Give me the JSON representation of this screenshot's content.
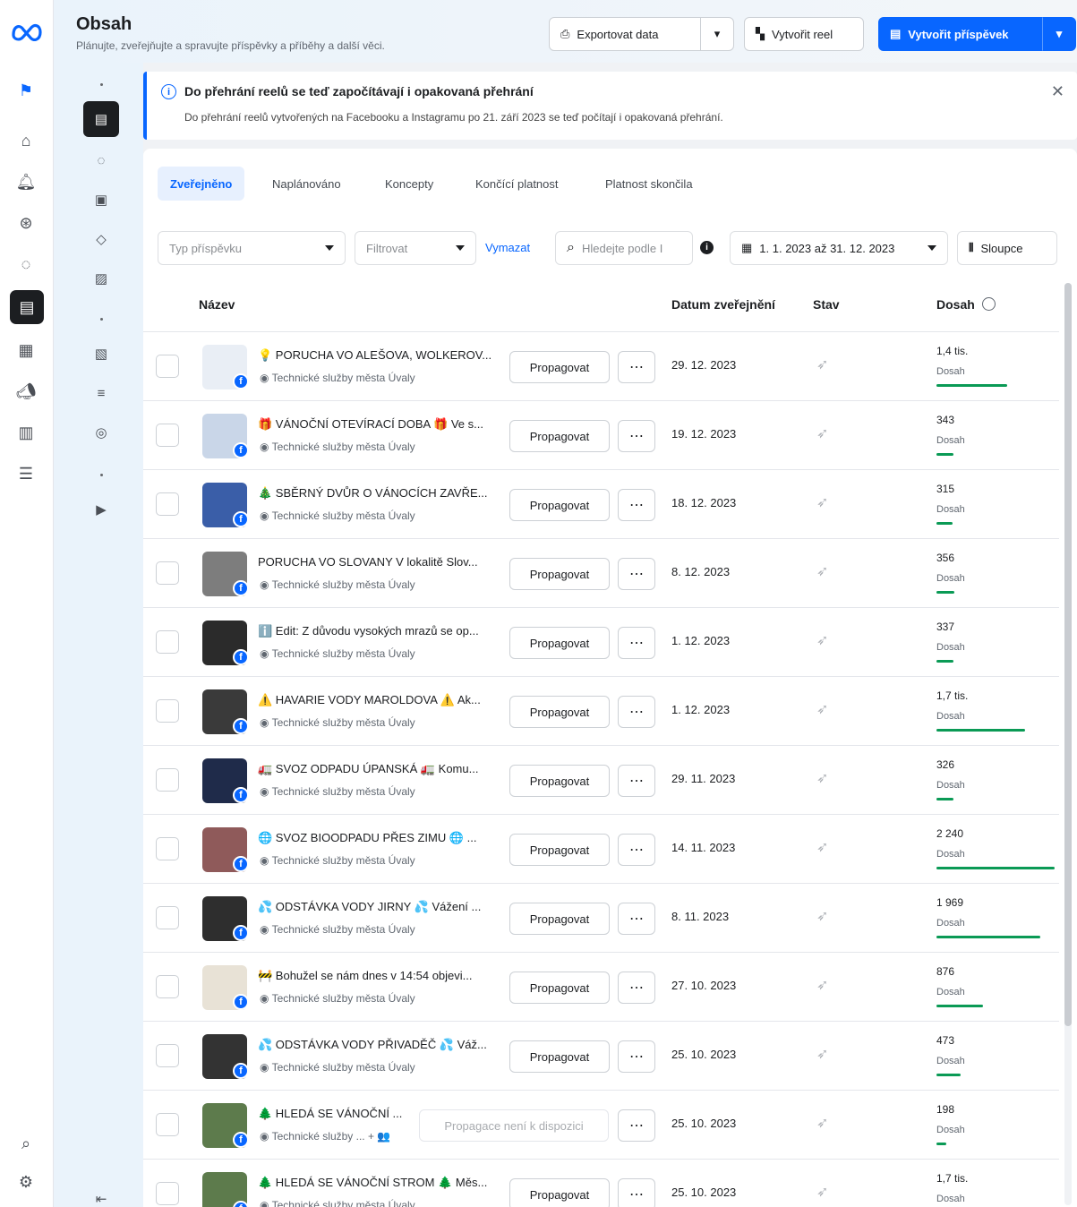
{
  "header": {
    "title": "Obsah",
    "subtitle": "Plánujte, zveřejňujte a spravujte příspěvky a příběhy a další věci.",
    "export_label": "Exportovat data",
    "create_reel_label": "Vytvořit reel",
    "create_post_label": "Vytvořit příspěvek"
  },
  "banner": {
    "title": "Do přehrání reelů se teď započítávají i opakovaná přehrání",
    "text": "Do přehrání reelů vytvořených na Facebooku a Instagramu po 21. září 2023 se teď počítají i opakovaná přehrání."
  },
  "tabs": [
    {
      "label": "Zveřejněno",
      "active": true
    },
    {
      "label": "Naplánováno"
    },
    {
      "label": "Koncepty"
    },
    {
      "label": "Končící platnost"
    },
    {
      "label": "Platnost skončila"
    }
  ],
  "filters": {
    "post_type_placeholder": "Typ příspěvku",
    "filter_placeholder": "Filtrovat",
    "clear_label": "Vymazat",
    "search_placeholder": "Hledejte podle I",
    "date_range": "1. 1. 2023 až 31. 12. 2023",
    "columns_label": "Sloupce"
  },
  "columns": {
    "name": "Název",
    "published": "Datum zveřejnění",
    "status": "Stav",
    "reach": "Dosah"
  },
  "rows": [
    {
      "title": "💡 PORUCHA VO ALEŠOVA, WOLKEROV...",
      "page": "Technické služby města Úvaly",
      "promo": "Propagovat",
      "date": "29. 12. 2023",
      "reach": "1,4 tis.",
      "reach_label": "Dosah",
      "reach_fraction": 0.58
    },
    {
      "title": "🎁 VÁNOČNÍ OTEVÍRACÍ DOBA 🎁 Ve s...",
      "page": "Technické služby města Úvaly",
      "promo": "Propagovat",
      "date": "19. 12. 2023",
      "reach": "343",
      "reach_label": "Dosah",
      "reach_fraction": 0.14
    },
    {
      "title": "🎄 SBĚRNÝ DVŮR O VÁNOCÍCH ZAVŘE...",
      "page": "Technické služby města Úvaly",
      "promo": "Propagovat",
      "date": "18. 12. 2023",
      "reach": "315",
      "reach_label": "Dosah",
      "reach_fraction": 0.13
    },
    {
      "title": "PORUCHA VO SLOVANY V lokalitě Slov...",
      "page": "Technické služby města Úvaly",
      "promo": "Propagovat",
      "date": "8. 12. 2023",
      "reach": "356",
      "reach_label": "Dosah",
      "reach_fraction": 0.15
    },
    {
      "title": "ℹ️ Edit: Z důvodu vysokých mrazů se op...",
      "page": "Technické služby města Úvaly",
      "promo": "Propagovat",
      "date": "1. 12. 2023",
      "reach": "337",
      "reach_label": "Dosah",
      "reach_fraction": 0.14
    },
    {
      "title": "⚠️ HAVARIE VODY MAROLDOVA ⚠️ Ak...",
      "page": "Technické služby města Úvaly",
      "promo": "Propagovat",
      "date": "1. 12. 2023",
      "reach": "1,7 tis.",
      "reach_label": "Dosah",
      "reach_fraction": 0.73
    },
    {
      "title": "🚛 SVOZ ODPADU ÚPANSKÁ 🚛 Komu...",
      "page": "Technické služby města Úvaly",
      "promo": "Propagovat",
      "date": "29. 11. 2023",
      "reach": "326",
      "reach_label": "Dosah",
      "reach_fraction": 0.14
    },
    {
      "title": "🌐 SVOZ BIOODPADU PŘES ZIMU 🌐 ...",
      "page": "Technické služby města Úvaly",
      "promo": "Propagovat",
      "date": "14. 11. 2023",
      "reach": "2 240",
      "reach_label": "Dosah",
      "reach_fraction": 0.97
    },
    {
      "title": "💦 ODSTÁVKA VODY JIRNY 💦 Vážení ...",
      "page": "Technické služby města Úvaly",
      "promo": "Propagovat",
      "date": "8. 11. 2023",
      "reach": "1 969",
      "reach_label": "Dosah",
      "reach_fraction": 0.85
    },
    {
      "title": "🚧 Bohužel se nám dnes v 14:54 objevi...",
      "page": "Technické služby města Úvaly",
      "promo": "Propagovat",
      "date": "27. 10. 2023",
      "reach": "876",
      "reach_label": "Dosah",
      "reach_fraction": 0.38
    },
    {
      "title": "💦 ODSTÁVKA VODY PŘIVADĚČ 💦 Váž...",
      "page": "Technické služby města Úvaly",
      "promo": "Propagovat",
      "date": "25. 10. 2023",
      "reach": "473",
      "reach_label": "Dosah",
      "reach_fraction": 0.2
    },
    {
      "title": "🌲 HLEDÁ SE VÁNOČNÍ ...",
      "page": "Technické služby ... + 👥",
      "promo": "Propagace není k dispozici",
      "promo_disabled": true,
      "date": "25. 10. 2023",
      "reach": "198",
      "reach_label": "Dosah",
      "reach_fraction": 0.08
    },
    {
      "title": "🌲 HLEDÁ SE VÁNOČNÍ STROM 🌲 Měs...",
      "page": "Technické služby města Úvaly",
      "promo": "Propagovat",
      "date": "25. 10. 2023",
      "reach": "1,7 tis.",
      "reach_label": "Dosah",
      "reach_fraction": 0.73
    }
  ],
  "colors": {
    "accent": "#0866ff",
    "reach_bar": "#0a9a55",
    "sidebar_bg": "#eaf3fb"
  }
}
